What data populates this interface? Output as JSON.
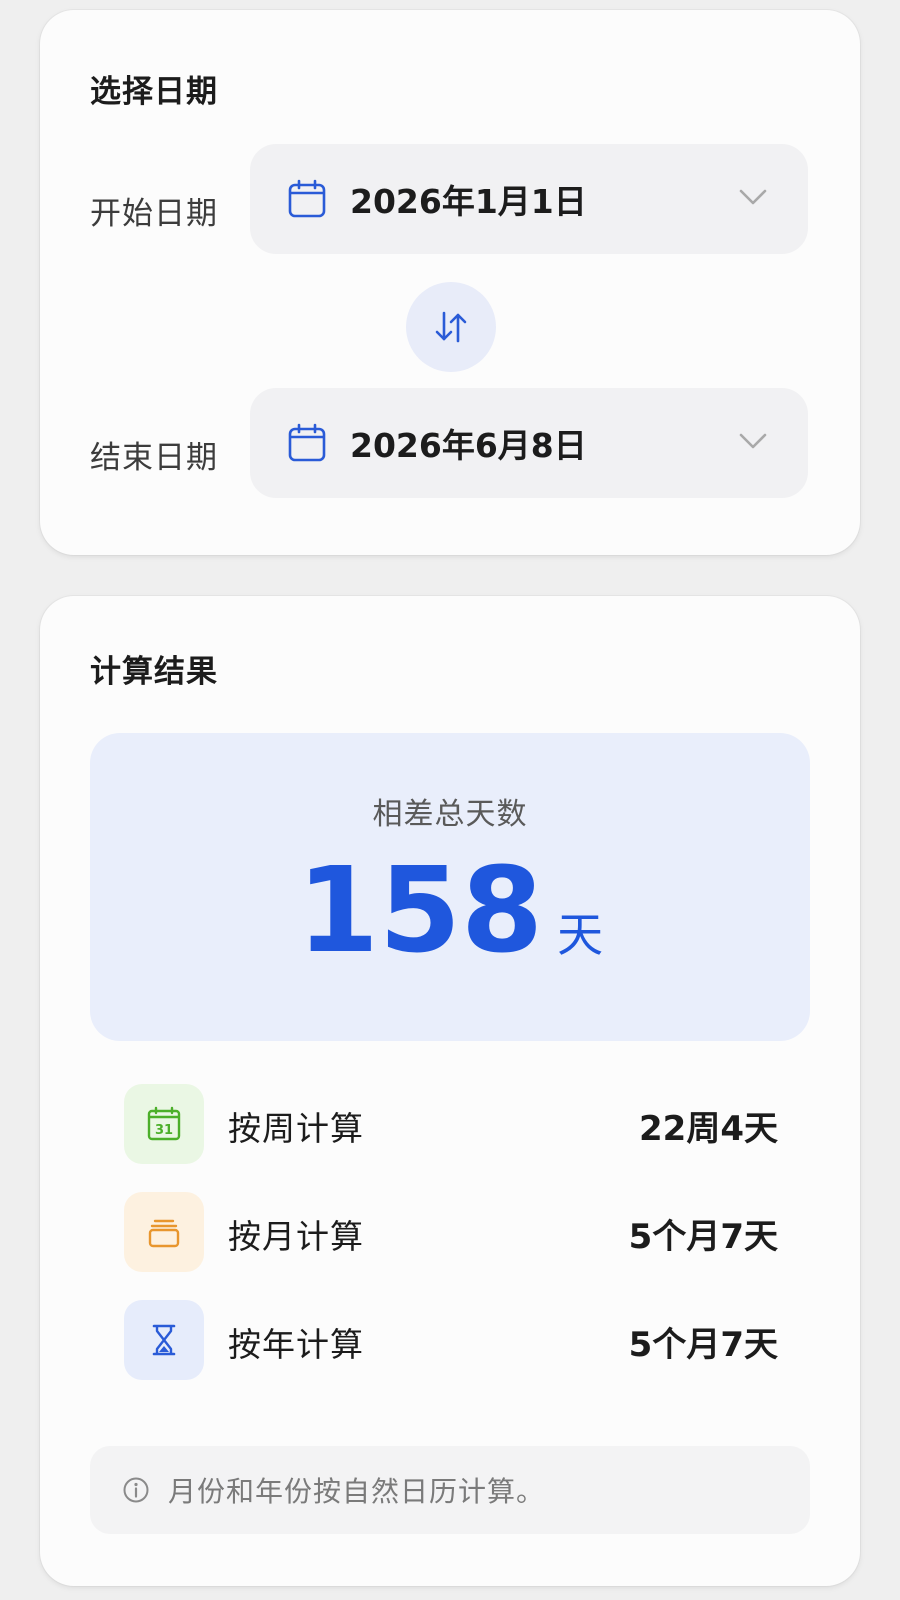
{
  "select_card": {
    "title": "选择日期",
    "start": {
      "label": "开始日期",
      "value": "2026年1月1日"
    },
    "end": {
      "label": "结束日期",
      "value": "2026年6月8日"
    }
  },
  "result_card": {
    "title": "计算结果",
    "total": {
      "label": "相差总天数",
      "value": "158",
      "unit": "天"
    },
    "breakdown": [
      {
        "icon": "calendar-31-icon",
        "label": "按周计算",
        "value": "22周4天",
        "color": "#4caf2a"
      },
      {
        "icon": "calendar-month-icon",
        "label": "按月计算",
        "value": "5个月7天",
        "color": "#e8962e"
      },
      {
        "icon": "hourglass-icon",
        "label": "按年计算",
        "value": "5个月7天",
        "color": "#2a5bd7"
      }
    ],
    "note": "月份和年份按自然日历计算。"
  },
  "colors": {
    "accent": "#1f57dd",
    "background": "#efefef",
    "card": "#fcfcfc"
  }
}
